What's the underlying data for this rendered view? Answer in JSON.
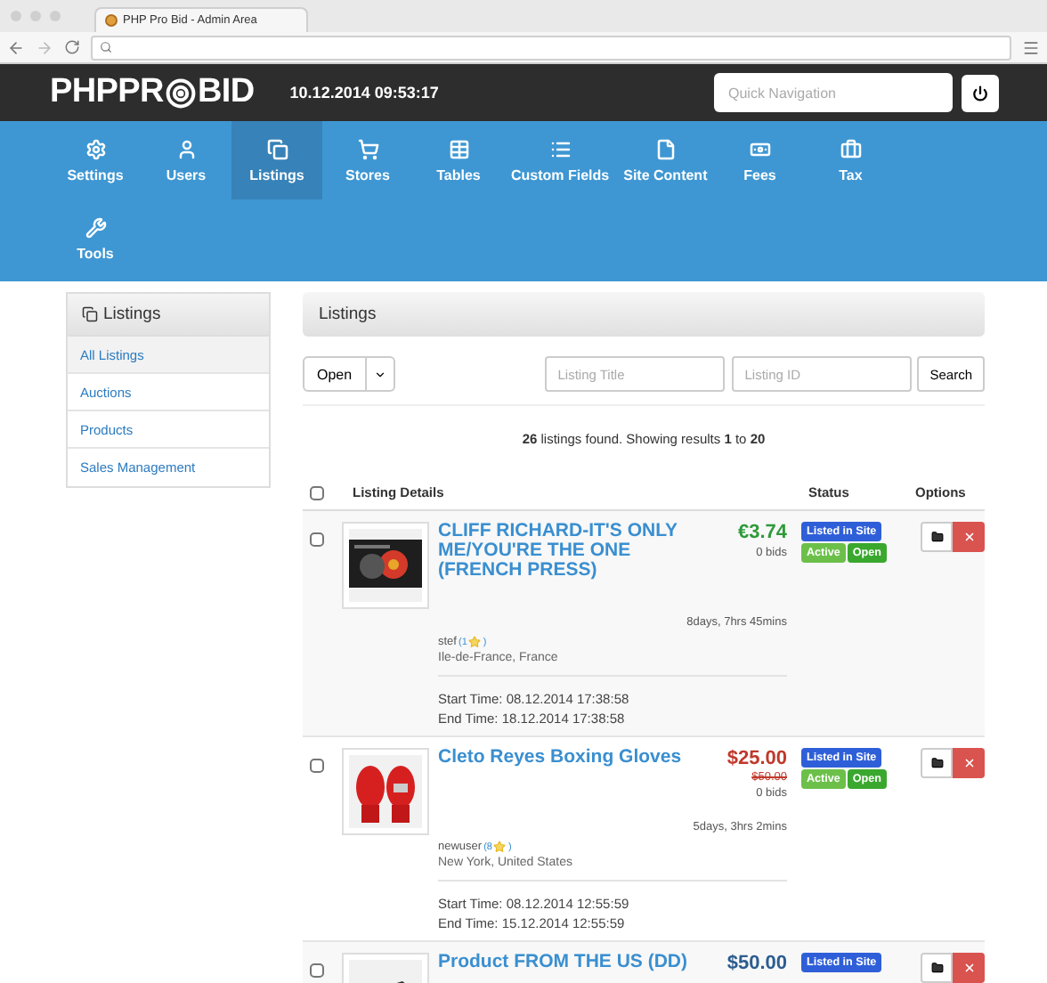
{
  "browser": {
    "tab_title": "PHP Pro Bid - Admin Area"
  },
  "header": {
    "logo_left": "PHPPR",
    "logo_right": "BID",
    "datetime": "10.12.2014 09:53:17",
    "quick_nav": {
      "placeholder": "Quick Navigation"
    }
  },
  "nav": [
    {
      "label": "Settings",
      "selected": false
    },
    {
      "label": "Users",
      "selected": false
    },
    {
      "label": "Listings",
      "selected": true
    },
    {
      "label": "Stores",
      "selected": false
    },
    {
      "label": "Tables",
      "selected": false
    },
    {
      "label": "Custom Fields",
      "selected": false
    },
    {
      "label": "Site Content",
      "selected": false
    },
    {
      "label": "Fees",
      "selected": false
    },
    {
      "label": "Tax",
      "selected": false
    },
    {
      "label": "Tools",
      "selected": false
    }
  ],
  "sidebar": {
    "title": "Listings",
    "items": [
      {
        "label": "All Listings",
        "selected": true
      },
      {
        "label": "Auctions",
        "selected": false
      },
      {
        "label": "Products",
        "selected": false
      },
      {
        "label": "Sales Management",
        "selected": false
      }
    ]
  },
  "panel": {
    "title": "Listings",
    "filter": "Open",
    "title_field": {
      "placeholder": "Listing Title"
    },
    "id_field": {
      "placeholder": "Listing ID"
    },
    "search_button": "Search",
    "summary": "**26** listings found. Showing results **1** to **20**",
    "columns": [
      "Listing Details",
      "Status",
      "Options"
    ],
    "select_all": {
      "checked": false
    },
    "listings": [
      {
        "checked": false,
        "title": "CLIFF RICHARD-IT'S ONLY ME/YOU'RE THE ONE (FRENCH PRESS)",
        "price": {
          "text": "€3.74",
          "color": "#2e9a3a"
        },
        "bids": "0 bids",
        "time_left": "8days, 7hrs 45mins",
        "seller": "stef",
        "rating": "(1",
        "rating_end": ")",
        "location": "Ile-de-France, France",
        "start": "Start Time: 08.12.2014 17:38:58",
        "end": "End Time: 18.12.2014 17:38:58",
        "statuses": [
          {
            "label": "Listed in Site",
            "color": "#2f5fd8"
          },
          {
            "label": "Active",
            "color": "#6cc04a"
          },
          {
            "label": "Open",
            "color": "#3aa82e"
          }
        ]
      },
      {
        "checked": false,
        "title": "Cleto Reyes Boxing Gloves",
        "price": {
          "text": "$25.00",
          "color": "#c0392b"
        },
        "old_price": "$50.00",
        "bids": "0 bids",
        "time_left": "5days, 3hrs 2mins",
        "seller": "newuser",
        "rating": "(8",
        "rating_end": ")",
        "location": "New York, United States",
        "start": "Start Time: 08.12.2014 12:55:59",
        "end": "End Time: 15.12.2014 12:55:59",
        "statuses": [
          {
            "label": "Listed in Site",
            "color": "#2f5fd8"
          },
          {
            "label": "Active",
            "color": "#6cc04a"
          },
          {
            "label": "Open",
            "color": "#3aa82e"
          }
        ]
      },
      {
        "checked": false,
        "title": "Product FROM THE US (DD)",
        "price": {
          "text": "$50.00",
          "color": "#2c5d8f"
        },
        "statuses": [
          {
            "label": "Listed in Site",
            "color": "#2f5fd8"
          }
        ]
      }
    ]
  }
}
